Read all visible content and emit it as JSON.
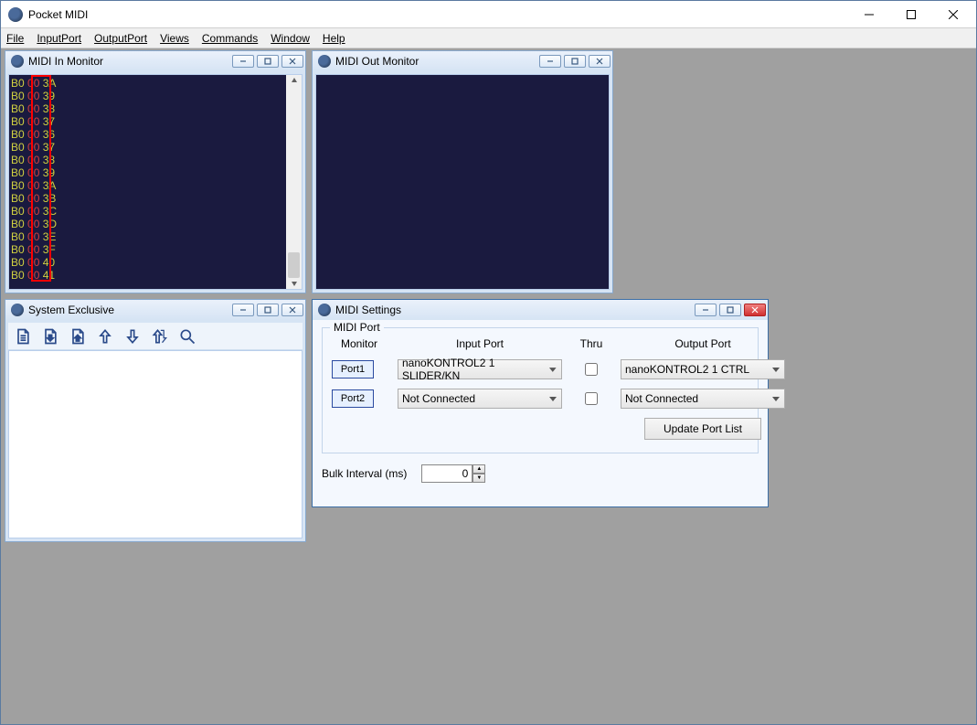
{
  "app": {
    "title": "Pocket MIDI"
  },
  "menu": [
    "File",
    "InputPort",
    "OutputPort",
    "Views",
    "Commands",
    "Window",
    "Help"
  ],
  "midi_in": {
    "title": "MIDI In Monitor",
    "rows": [
      [
        "B0",
        "00",
        "3A"
      ],
      [
        "B0",
        "00",
        "39"
      ],
      [
        "B0",
        "00",
        "38"
      ],
      [
        "B0",
        "00",
        "37"
      ],
      [
        "B0",
        "00",
        "36"
      ],
      [
        "B0",
        "00",
        "37"
      ],
      [
        "B0",
        "00",
        "38"
      ],
      [
        "B0",
        "00",
        "39"
      ],
      [
        "B0",
        "00",
        "3A"
      ],
      [
        "B0",
        "00",
        "3B"
      ],
      [
        "B0",
        "00",
        "3C"
      ],
      [
        "B0",
        "00",
        "3D"
      ],
      [
        "B0",
        "00",
        "3E"
      ],
      [
        "B0",
        "00",
        "3F"
      ],
      [
        "B0",
        "00",
        "40"
      ],
      [
        "B0",
        "00",
        "41"
      ]
    ]
  },
  "midi_out": {
    "title": "MIDI Out Monitor"
  },
  "sysex": {
    "title": "System Exclusive"
  },
  "settings": {
    "title": "MIDI Settings",
    "group": "MIDI Port",
    "headers": {
      "monitor": "Monitor",
      "input": "Input Port",
      "thru": "Thru",
      "output": "Output Port"
    },
    "port1": {
      "label": "Port1",
      "input": "nanoKONTROL2 1 SLIDER/KN",
      "output": "nanoKONTROL2 1 CTRL"
    },
    "port2": {
      "label": "Port2",
      "input": "Not Connected",
      "output": "Not Connected"
    },
    "update": "Update Port List",
    "bulk_label": "Bulk Interval (ms)",
    "bulk_value": "0"
  }
}
